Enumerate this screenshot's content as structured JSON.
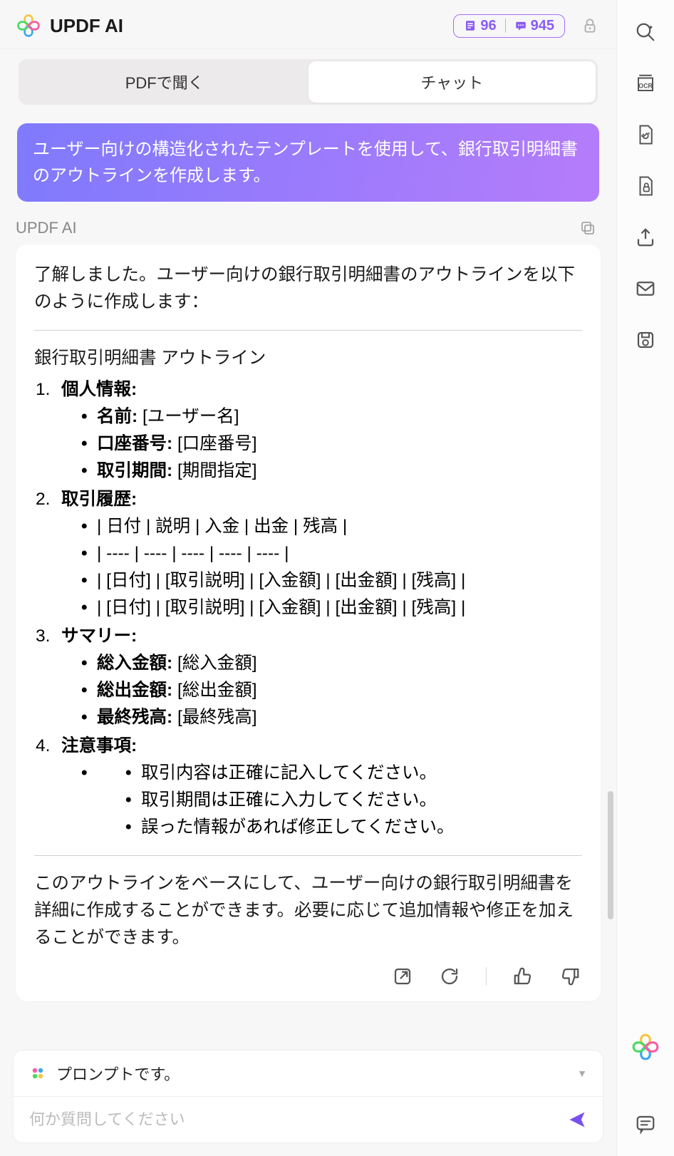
{
  "header": {
    "title": "UPDF AI",
    "doc_count": "96",
    "msg_count": "945"
  },
  "tabs": {
    "pdf": "PDFで聞く",
    "chat": "チャット"
  },
  "user_message": "ユーザー向けの構造化されたテンプレートを使用して、銀行取引明細書のアウトラインを作成します。",
  "ai_label": "UPDF AI",
  "response": {
    "intro": "了解しました。ユーザー向けの銀行取引明細書のアウトラインを以下のように作成します：",
    "outline_title": "銀行取引明細書 アウトライン",
    "sections": [
      {
        "head": "個人情報:",
        "items": [
          {
            "label": "名前:",
            "val": " [ユーザー名]"
          },
          {
            "label": "口座番号:",
            "val": " [口座番号]"
          },
          {
            "label": "取引期間:",
            "val": " [期間指定]"
          }
        ]
      },
      {
        "head": "取引履歴:",
        "rows": [
          "| 日付 | 説明 | 入金 | 出金 | 残高 |",
          "| ---- | ---- | ---- | ---- | ---- |",
          "| [日付] | [取引説明] | [入金額] | [出金額] | [残高] |",
          "| [日付] | [取引説明] | [入金額] | [出金額] | [残高] |"
        ]
      },
      {
        "head": "サマリー:",
        "items": [
          {
            "label": "総入金額:",
            "val": " [総入金額]"
          },
          {
            "label": "総出金額:",
            "val": " [総出金額]"
          },
          {
            "label": "最終残高:",
            "val": " [最終残高]"
          }
        ]
      },
      {
        "head": "注意事項:",
        "empty": "",
        "notes": [
          "取引内容は正確に記入してください。",
          "取引期間は正確に入力してください。",
          "誤った情報があれば修正してください。"
        ]
      }
    ],
    "footer": "このアウトラインをベースにして、ユーザー向けの銀行取引明細書を詳細に作成することができます。必要に応じて追加情報や修正を加えることができます。"
  },
  "input": {
    "prompt_label": "プロンプトです。",
    "placeholder": "何か質問してください"
  }
}
